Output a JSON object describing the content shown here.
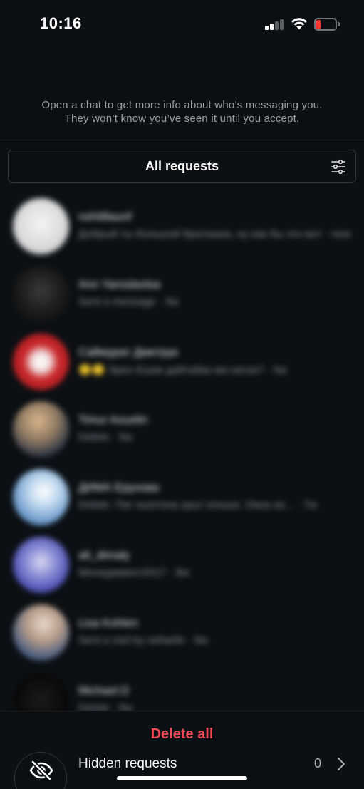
{
  "status_bar": {
    "time": "10:16"
  },
  "info": {
    "line1": "Open a chat to get more info about who’s messaging you.",
    "line2": "They won’t know you’ve seen it until you accept."
  },
  "filter": {
    "label": "All requests",
    "icon": "sliders-icon"
  },
  "requests": [
    {
      "name": "nsh98aunf",
      "preview": "Добрый ты большой братишка, ну как бы это вот · now",
      "avatar_bg": "radial-gradient(circle at 50% 45%, #f4f4f4 0%, #d9dadb 55%, #b7b8ba 100%)"
    },
    {
      "name": "Ann Yaroslavtsa",
      "preview": "Sent a message · 3w",
      "avatar_bg": "radial-gradient(circle at 50% 45%, #3a3a3a 0%, #1c1c1c 50%, #0d0d0d 100%)"
    },
    {
      "name": "Саймурат Дмитрук",
      "preview": "🙂🙂 Эрен Ешик дайтабак ма несек? · 5w",
      "avatar_bg": "radial-gradient(circle at 50% 50%, #ffffff 0%, #f0e0e0 22%, #c8272a 45%, #9e1a1c 100%)"
    },
    {
      "name": "Timur Aouelin",
      "preview": "Delete · 5w",
      "avatar_bg": "radial-gradient(circle at 45% 35%, #d9b58a 0%, #8f7a63 40%, #2b3342 75%, #1a2030 100%)"
    },
    {
      "name": "ДИМА Ерунова",
      "preview": "Delete. Пиг ньютона хрыг конька. Окна не... · 7w",
      "avatar_bg": "radial-gradient(circle at 55% 40%, #ffffff 0%, #c5dbf0 30%, #6f9ccb 65%, #3f6ea5 100%)"
    },
    {
      "name": "alt_dimaly",
      "preview": "Менеджмент2017 · 8w",
      "avatar_bg": "radial-gradient(circle at 50% 45%, #d8d9f0 0%, #8b8fd6 35%, #4b4fb0 70%, #2f3486 100%)"
    },
    {
      "name": "Lisa Kohlen",
      "preview": "Sent a reel by oefwefe · 9w",
      "avatar_bg": "radial-gradient(circle at 55% 35%, #e8d8cc 0%, #b79c8a 35%, #4c5f80 70%, #2a3550 100%)"
    },
    {
      "name": "Michael.D",
      "preview": "Delete · 9w",
      "avatar_bg": "radial-gradient(circle at 50% 50%, #1b1b1b 0%, #0a0a0a 60%, #050505 100%)"
    }
  ],
  "bottom": {
    "delete_all": "Delete all",
    "hidden_label": "Hidden requests",
    "hidden_count": "0",
    "hidden_icon": "eye-off-icon",
    "chevron_icon": "chevron-right-icon"
  },
  "colors": {
    "background": "#0c1014",
    "danger": "#ed4956",
    "muted": "#9a9da1"
  }
}
